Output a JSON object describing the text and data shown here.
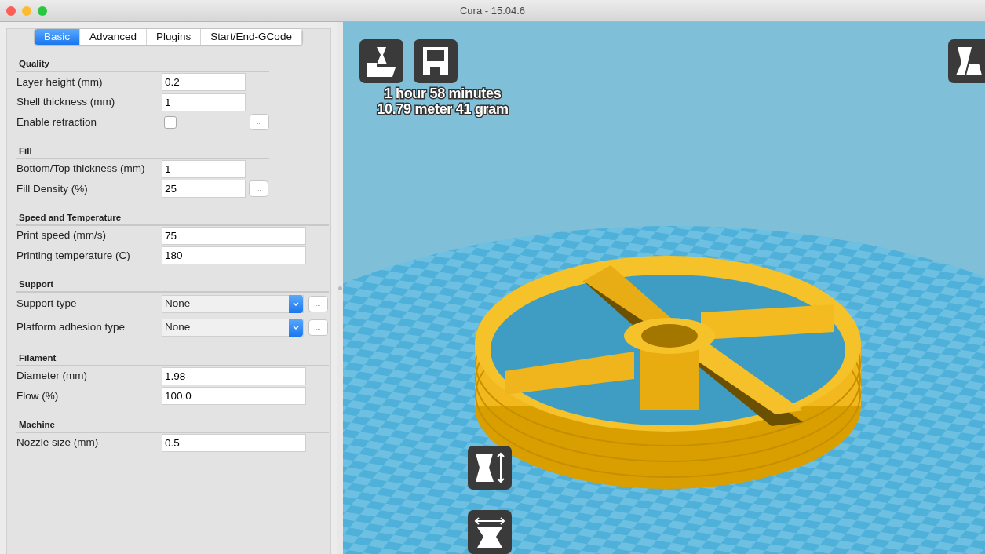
{
  "window": {
    "title": "Cura - 15.04.6"
  },
  "tabs": [
    {
      "label": "Basic",
      "selected": true
    },
    {
      "label": "Advanced",
      "selected": false
    },
    {
      "label": "Plugins",
      "selected": false
    },
    {
      "label": "Start/End-GCode",
      "selected": false
    }
  ],
  "sections": [
    {
      "title": "Quality",
      "rows": [
        {
          "kind": "short_text",
          "label": "Layer height (mm)",
          "value": "0.2"
        },
        {
          "kind": "short_text",
          "label": "Shell thickness (mm)",
          "value": "1"
        },
        {
          "kind": "checkbox",
          "label": "Enable retraction",
          "checked": false,
          "more": "..."
        }
      ]
    },
    {
      "title": "Fill",
      "rows": [
        {
          "kind": "short_text",
          "label": "Bottom/Top thickness (mm)",
          "value": "1"
        },
        {
          "kind": "short_text",
          "label": "Fill Density (%)",
          "value": "25",
          "more": "..."
        }
      ]
    },
    {
      "title": "Speed and Temperature",
      "rows": [
        {
          "kind": "text",
          "label": "Print speed (mm/s)",
          "value": "75"
        },
        {
          "kind": "text",
          "label": "Printing temperature (C)",
          "value": "180"
        }
      ]
    },
    {
      "title": "Support",
      "rows": [
        {
          "kind": "select",
          "label": "Support type",
          "value": "None",
          "more": "..."
        },
        {
          "kind": "select",
          "label": "Platform adhesion type",
          "value": "None",
          "more": "..."
        }
      ]
    },
    {
      "title": "Filament",
      "rows": [
        {
          "kind": "text",
          "label": "Diameter (mm)",
          "value": "1.98"
        },
        {
          "kind": "text",
          "label": "Flow (%)",
          "value": "100.0"
        }
      ]
    },
    {
      "title": "Machine",
      "rows": [
        {
          "kind": "text",
          "label": "Nozzle size (mm)",
          "value": "0.5"
        }
      ]
    }
  ],
  "print_stats": [
    "1 hour 58 minutes",
    "10.79 meter 41 gram"
  ]
}
